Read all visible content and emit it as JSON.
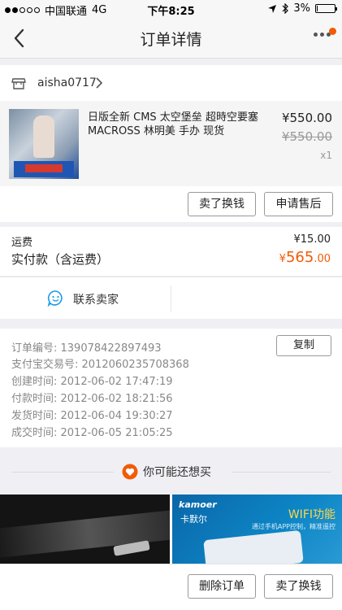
{
  "status_bar": {
    "carrier": "中国联通",
    "network": "4G",
    "time": "下午8:25",
    "battery": "3%",
    "battery_level": 0.03,
    "signal_bars_filled": 2,
    "signal_bars_total": 5
  },
  "nav": {
    "title": "订单详情",
    "back_icon": "chevron-left-icon",
    "more_icon": "more-dots-icon",
    "accent": "#f25a06"
  },
  "seller": {
    "name": "aisha0717",
    "icon": "store-icon"
  },
  "item": {
    "title": "日版全新 CMS 太空堡垒 超時空要塞 MACROSS 林明美 手办 现货",
    "price": "¥550.00",
    "original_price": "¥550.00",
    "quantity": "x1"
  },
  "item_actions": {
    "sell": "卖了换钱",
    "after_sale": "申请售后"
  },
  "totals": {
    "shipping_label": "运费",
    "shipping_value": "¥15.00",
    "paid_label": "实付款（含运费）",
    "paid_currency": "¥",
    "paid_integer": "565",
    "paid_decimal": ".00"
  },
  "contact": {
    "label": "联系卖家",
    "icon": "chat-smile-icon"
  },
  "order_info": {
    "copy_label": "复制",
    "rows": [
      "订单编号:  139078422897493",
      "支付宝交易号:  2012060235708368",
      "创建时间:  2012-06-02 17:47:19",
      "付款时间:  2012-06-02 18:21:56",
      "发货时间:  2012-06-04 19:30:27",
      "成交时间:  2012-06-05 21:05:25"
    ]
  },
  "recommend": {
    "label": "你可能还想买",
    "icon": "heart-icon",
    "product2": {
      "brand": "kamoer",
      "brand_cn": "卡默尔",
      "feature": "WIFI功能",
      "desc": "通过手机APP控制，精准遥控"
    }
  },
  "bottom_actions": {
    "delete": "删除订单",
    "sell": "卖了换钱"
  }
}
